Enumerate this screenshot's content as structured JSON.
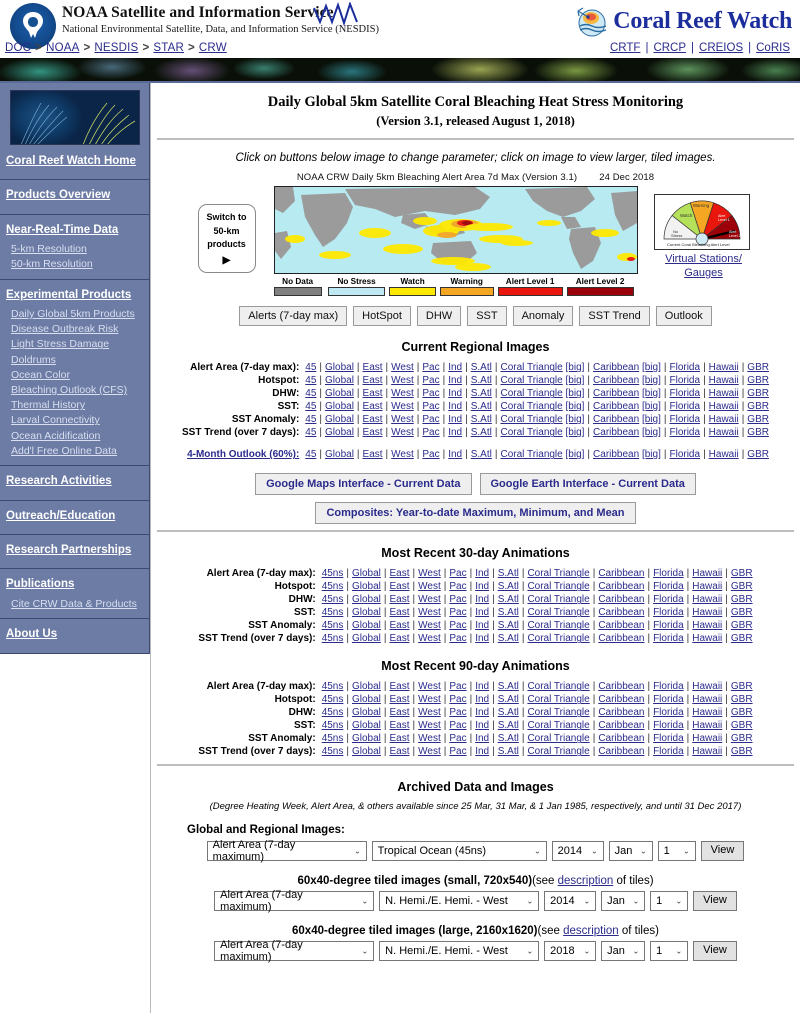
{
  "header": {
    "agency_title": "NOAA Satellite and Information Service",
    "agency_sub": "National Environmental Satellite, Data, and Information Service (NESDIS)",
    "logo_icon": "noaa-seal-icon",
    "wave_icon": "wave-squiggle-icon",
    "crw_logo_text": "Coral Reef Watch",
    "crw_globe_icon": "coral-reef-watch-globe-icon",
    "breadcrumb": [
      "DOC",
      "NOAA",
      "NESDIS",
      "STAR",
      "CRW"
    ],
    "breadcrumb_sep": ">",
    "top_links": [
      "CRTF",
      "CRCP",
      "CREIOS",
      "CoRIS"
    ],
    "top_links_sep": "|"
  },
  "sidebar": {
    "photo_alt": "sea-fan-coral-photo",
    "groups": [
      {
        "heads": [
          "Coral Reef Watch Home"
        ],
        "items": []
      },
      {
        "heads": [
          "Products Overview"
        ],
        "items": []
      },
      {
        "heads": [
          "Near-Real-Time Data"
        ],
        "items": [
          "5-km Resolution",
          "50-km Resolution"
        ]
      },
      {
        "heads": [
          "Experimental Products"
        ],
        "items": [
          "Daily Global 5km Products",
          "Disease Outbreak Risk",
          "Light Stress Damage",
          "Doldrums",
          "Ocean Color",
          "Bleaching Outlook (CFS)",
          "Thermal History",
          "Larval Connectivity",
          "Ocean Acidification",
          "Add'l Free Online Data"
        ]
      },
      {
        "heads": [
          "Research Activities"
        ],
        "items": []
      },
      {
        "heads": [
          "Outreach/Education"
        ],
        "items": []
      },
      {
        "heads": [
          "Research Partnerships"
        ],
        "items": []
      },
      {
        "heads": [
          "Publications"
        ],
        "items": [
          "Cite CRW Data & Products"
        ]
      },
      {
        "heads": [
          "About Us"
        ],
        "items": []
      }
    ]
  },
  "main": {
    "title_line1": "Daily Global 5km Satellite Coral Bleaching Heat Stress Monitoring",
    "title_line2": "(Version 3.1, released August 1, 2018)",
    "instruction": "Click on buttons below image to change parameter; click on image to view larger, tiled images.",
    "image_caption": "NOAA CRW Daily 5km  Bleaching Alert Area 7d Max (Version 3.1)",
    "image_date": "24 Dec 2018",
    "switch_button": {
      "line1": "Switch to",
      "line2": "50-km",
      "line3": "products",
      "arrow": "▶"
    },
    "legend": [
      {
        "label": "No Data",
        "color": "#808080"
      },
      {
        "label": "No Stress",
        "color": "#bfe9f2"
      },
      {
        "label": "Watch",
        "color": "#ffe800"
      },
      {
        "label": "Warning",
        "color": "#f5a623"
      },
      {
        "label": "Alert Level 1",
        "color": "#e8160c"
      },
      {
        "label": "Alert Level 2",
        "color": "#9c0008"
      }
    ],
    "gauge": {
      "icon": "bleaching-alert-gauge-icon",
      "caption": "Current Coral Bleaching Alert Level",
      "segments": [
        "No Stress",
        "Watch",
        "Warning",
        "Alert Level 1",
        "Alert Level 2"
      ],
      "link_line1": "Virtual Stations/",
      "link_line2": "Gauges"
    },
    "param_buttons": [
      "Alerts (7-day max)",
      "HotSpot",
      "DHW",
      "SST",
      "Anomaly",
      "SST Trend",
      "Outlook"
    ],
    "google_buttons": [
      "Google Maps Interface - Current Data",
      "Google Earth Interface - Current Data"
    ],
    "composites_button": "Composites: Year-to-date Maximum, Minimum, and Mean"
  },
  "regional": {
    "heading": "Current Regional Images",
    "rows": [
      {
        "label": "Alert Area (7-day max):",
        "label_link": false
      },
      {
        "label": "Hotspot:",
        "label_link": false
      },
      {
        "label": "DHW:",
        "label_link": false
      },
      {
        "label": "SST:",
        "label_link": false
      },
      {
        "label": "SST Anomaly:",
        "label_link": false
      },
      {
        "label": "SST Trend (over 7 days):",
        "label_link": false
      }
    ],
    "outlook_row": {
      "label": "4-Month Outlook (60%):",
      "label_link": true
    },
    "links": [
      "45",
      "Global",
      "East",
      "West",
      "Pac",
      "Ind",
      "S.Atl",
      "Coral Triangle",
      "Caribbean",
      "Florida",
      "Hawaii",
      "GBR"
    ],
    "big_label": "[big]",
    "big_after": [
      "Coral Triangle",
      "Caribbean"
    ]
  },
  "anim30": {
    "heading": "Most Recent 30-day Animations",
    "rows": [
      "Alert Area (7-day max):",
      "Hotspot:",
      "DHW:",
      "SST:",
      "SST Anomaly:",
      "SST Trend (over 7 days):"
    ],
    "links": [
      "45ns",
      "Global",
      "East",
      "West",
      "Pac",
      "Ind",
      "S.Atl",
      "Coral Triangle",
      "Caribbean",
      "Florida",
      "Hawaii",
      "GBR"
    ]
  },
  "anim90": {
    "heading": "Most Recent 90-day Animations",
    "rows": [
      "Alert Area (7-day max):",
      "Hotspot:",
      "DHW:",
      "SST:",
      "SST Anomaly:",
      "SST Trend (over 7 days):"
    ],
    "links": [
      "45ns",
      "Global",
      "East",
      "West",
      "Pac",
      "Ind",
      "S.Atl",
      "Coral Triangle",
      "Caribbean",
      "Florida",
      "Hawaii",
      "GBR"
    ]
  },
  "archive": {
    "heading": "Archived Data and Images",
    "note": "(Degree Heating Week, Alert Area, & others available since 25 Mar, 31 Mar, & 1 Jan 1985, respectively, and until 31 Dec 2017)",
    "global_label": "Global and Regional Images:",
    "global_form": {
      "param": "Alert Area (7-day maximum)",
      "region": "Tropical Ocean (45ns)",
      "year": "2014",
      "month": "Jan",
      "day": "1",
      "view": "View"
    },
    "small_tiles": {
      "title_bold": "60x40-degree tiled images (small, 720x540)",
      "title_rest_pre": "(see ",
      "title_link": "description",
      "title_rest_post": " of tiles)",
      "param": "Alert Area (7-day maximum)",
      "region": "N. Hemi./E. Hemi. - West",
      "year": "2014",
      "month": "Jan",
      "day": "1",
      "view": "View"
    },
    "large_tiles": {
      "title_bold": "60x40-degree tiled images (large, 2160x1620)",
      "title_rest_pre": "(see ",
      "title_link": "description",
      "title_rest_post": " of tiles)",
      "param": "Alert Area (7-day maximum)",
      "region": "N. Hemi./E. Hemi. - West",
      "year": "2018",
      "month": "Jan",
      "day": "1",
      "view": "View"
    },
    "chevron": "⌄"
  }
}
